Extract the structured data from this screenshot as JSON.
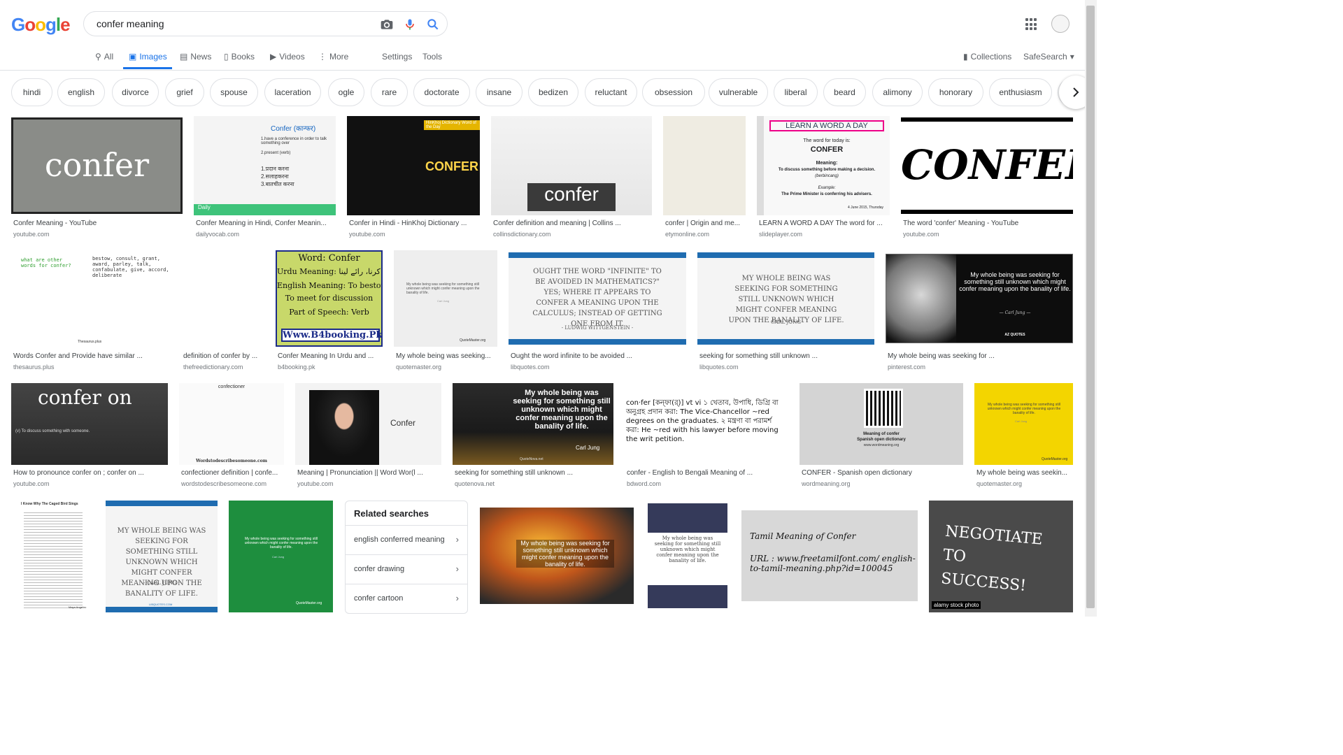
{
  "header": {
    "logo": {
      "letters": [
        "G",
        "o",
        "o",
        "g",
        "l",
        "e"
      ],
      "colors": [
        "#4285F4",
        "#EA4335",
        "#FBBC05",
        "#4285F4",
        "#34A853",
        "#EA4335"
      ]
    },
    "search": {
      "value": "confer meaning"
    }
  },
  "tabs": {
    "all": "All",
    "images": "Images",
    "news": "News",
    "books": "Books",
    "videos": "Videos",
    "more": "More",
    "settings": "Settings",
    "tools": "Tools",
    "collections": "Collections",
    "safesearch": "SafeSearch"
  },
  "chips": [
    "hindi",
    "english",
    "divorce",
    "grief",
    "spouse",
    "laceration",
    "ogle",
    "rare",
    "doctorate",
    "insane",
    "bedizen",
    "reluctant",
    "obsession",
    "vulnerable",
    "liberal",
    "beard",
    "alimony",
    "honorary",
    "enthusiasm"
  ],
  "results": [
    {
      "title": "Confer Meaning - YouTube",
      "source": "youtube.com"
    },
    {
      "title": "Confer Meaning in Hindi, Confer Meanin...",
      "source": "dailyvocab.com"
    },
    {
      "title": "Confer in Hindi - HinKhoj Dictionary ...",
      "source": "youtube.com"
    },
    {
      "title": "Confer definition and meaning | Collins ...",
      "source": "collinsdictionary.com"
    },
    {
      "title": "confer | Origin and me...",
      "source": "etymonline.com"
    },
    {
      "title": "LEARN A WORD A DAY The word for ...",
      "source": "slideplayer.com"
    },
    {
      "title": "The word 'confer' Meaning - YouTube",
      "source": "youtube.com"
    },
    {
      "title": "Words Confer and Provide have similar ...",
      "source": "thesaurus.plus"
    },
    {
      "title": "definition of confer by ...",
      "source": "thefreedictionary.com"
    },
    {
      "title": "Confer Meaning In Urdu and ...",
      "source": "b4booking.pk"
    },
    {
      "title": "My whole being was seeking...",
      "source": "quotemaster.org"
    },
    {
      "title": "Ought the word infinite to be avoided ...",
      "source": "libquotes.com"
    },
    {
      "title": "seeking for something still unknown ...",
      "source": "libquotes.com"
    },
    {
      "title": "My whole being was seeking for ...",
      "source": "pinterest.com"
    },
    {
      "title": "How to pronounce confer on ; confer on ...",
      "source": "youtube.com"
    },
    {
      "title": "confectioner definition | confe...",
      "source": "wordstodescribesomeone.com"
    },
    {
      "title": "Meaning | Pronunciation || Word Wor(l ...",
      "source": "youtube.com"
    },
    {
      "title": "seeking for something still unknown ...",
      "source": "quotenova.net"
    },
    {
      "title": "confer - English to Bengali Meaning of ...",
      "source": "bdword.com"
    },
    {
      "title": "CONFER - Spanish open dictionary",
      "source": "wordmeaning.org"
    },
    {
      "title": "My whole being was seekin...",
      "source": "quotemaster.org"
    }
  ],
  "image_text": {
    "confer1": "confer",
    "dv_title": "Confer (कान्फर)",
    "dv_line1": "1.have a conference in order to talk something over",
    "dv_line2": "2.present (verb)",
    "dv_hindi": "1.प्रदान करना\n2.सलाहकरना\n3.बातचीत करना",
    "dv_brand": "Daily",
    "hk_word": "CONFER",
    "hk_tag": "HinKhoj Dictionary Word of the Day",
    "collins_word": "confer",
    "lwad_head": "LEARN A WORD A DAY",
    "lwad_today": "The word for today is:",
    "lwad_word": "CONFER",
    "lwad_meaning_label": "Meaning:",
    "lwad_meaning": "To discuss something before making a decision.",
    "lwad_malay": "(berbincang)",
    "lwad_example_label": "Example:",
    "lwad_example": "The Prime Minister is conferring his advisers.",
    "lwad_date": "4 June 2015, Thursday",
    "big_confer": "CONFER",
    "ths_left": "what are other words for confer?",
    "ths_right": "bestow, consult, grant, award, parley, talk, confabulate, give, accord, deliberate",
    "ths_brand": "Thesaurus.plus",
    "urdu_l1": "Word: Confer",
    "urdu_l2": "Urdu Meaning: عطا کرنا، رائے لینا",
    "urdu_l3": "English Meaning: To bestow,",
    "urdu_l4": "To meet for discussion",
    "urdu_l5": "Part of Speech: Verb",
    "urdu_url": "Www.B4booking.Pk",
    "qm_quote": "My whole being was seeking for something still unknown which might confer meaning upon the banality of life.",
    "qm_author": "Carl Jung",
    "qm_brand": "QuoteMaster.org",
    "witt_quote": "OUGHT THE WORD \"INFINITE\" TO BE AVOIDED IN MATHEMATICS?\" YES; WHERE IT APPEARS TO CONFER A MEANING UPON THE CALCULUS; INSTEAD OF GETTING ONE FROM IT.",
    "witt_author": "- LUDWIG WITTGENSTEIN -",
    "lib_brand": "LIBQUOTES.COM",
    "jung_quote_caps": "MY WHOLE BEING WAS SEEKING FOR SOMETHING STILL UNKNOWN WHICH MIGHT CONFER MEANING UPON THE BANALITY OF LIFE.",
    "jung_author_caps": "- CARL JUNG -",
    "az_quote": "My whole being was seeking for something still unknown which might confer meaning upon the banality of life.",
    "az_author": "— Carl Jung —",
    "az_brand": "AZ QUOTES",
    "conferon_word": "confer on",
    "conferon_def": "(v) To discuss something with someone.",
    "wd_title": "confectioner",
    "wd_brand": "Wordstodescribesomeone.com",
    "yt_confer": "Confer",
    "qn_quote": "My whole being was seeking for something still unknown which might confer meaning upon the banality of life.",
    "qn_author": "Carl Jung",
    "qn_brand": "QuoteNova.net",
    "bd_text": "con·fer [কন্‌ফা(র্)] vt vi ১ খেতাব, উপাধি, ডিগ্রি বা অনুগ্রহ প্রদান করা: The Vice-Chancellor ~red degrees on the graduates. ২ মন্ত্রণা বা পরামর্শ করা: He ~red with his lawyer before moving the writ petition.",
    "wm_line1": "Meaning of confer",
    "wm_line2": "Spanish open dictionary",
    "wm_url": "www.wordmeaning.org",
    "cb_title": "I Know Why The Caged Bird Sings",
    "cb_author": "Maya Angelou",
    "rel_title": "Related searches",
    "rel_items": [
      "english conferred meaning",
      "confer drawing",
      "confer cartoon"
    ],
    "sun_quote": "My whole being was seeking for something still unknown which might confer meaning upon the banality of life.",
    "tamil_title": "Tamil Meaning of Confer",
    "tamil_url": "URL : www.freetamilfont.com/ english-to-tamil-meaning.php?id=100045",
    "neg_text": "NEGOTIATE TO SUCCESS!",
    "alamy": "alamy stock photo"
  }
}
